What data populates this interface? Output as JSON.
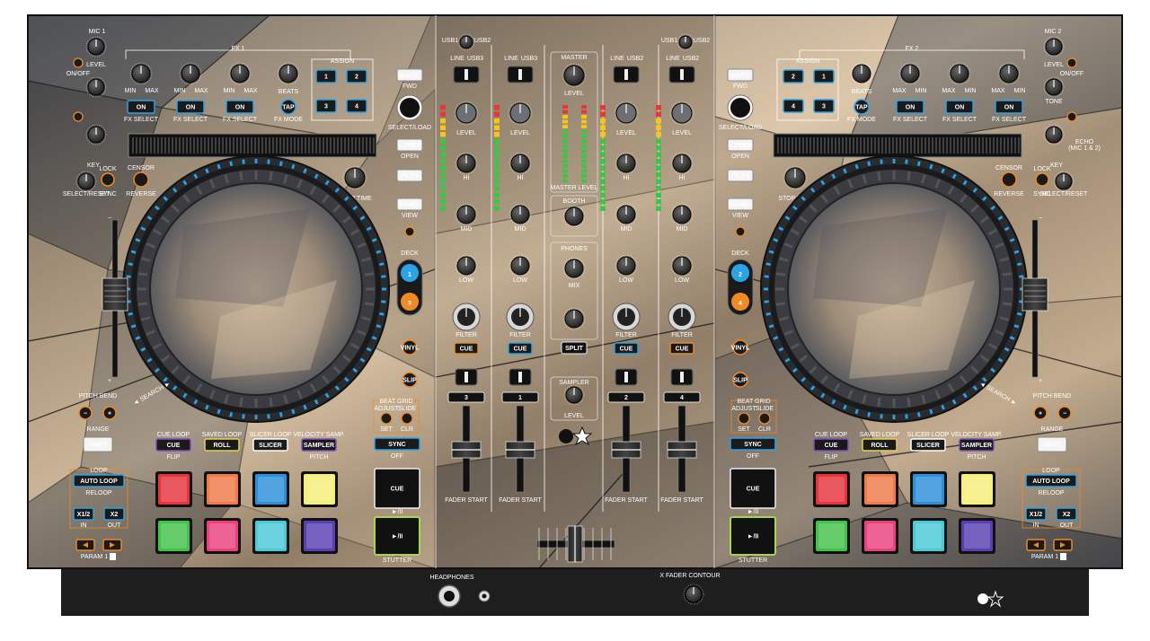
{
  "colors": {
    "blue_accent": "#2aa3e8",
    "orange_accent": "#f08a24",
    "purple_accent": "#7b4fc4",
    "yellow_accent": "#e8d34a",
    "frame": "#1a1a1a"
  },
  "mic": {
    "mic1": "MIC 1",
    "mic2": "MIC 2",
    "level": "LEVEL",
    "tone": "TONE",
    "echo": "ECHO",
    "echo_sub": "(MIC 1 & 2)",
    "onoff": "ON/OFF"
  },
  "fx": {
    "fx1": "FX 1",
    "fx2": "FX 2",
    "on": "ON",
    "fx_select": "FX SELECT",
    "beats": "BEATS",
    "tap": "TAP",
    "fx_mode": "FX MODE",
    "assign": "ASSIGN",
    "assign_buttons": [
      "1",
      "2",
      "3",
      "4"
    ],
    "min": "MIN",
    "max": "MAX"
  },
  "nav": {
    "back": "BACK",
    "fwd": "FWD",
    "select_load": "SELECT/LOAD",
    "lprep": "L.PREP",
    "open": "OPEN",
    "files": "FILES",
    "panel": "PANEL",
    "view": "VIEW",
    "deck": "DECK"
  },
  "deck_left": {
    "deck_a": "1",
    "deck_b": "3"
  },
  "deck_right": {
    "deck_a": "2",
    "deck_b": "4"
  },
  "jog": {
    "needle_drop": "NEEDLE DROP",
    "search": "SEARCH"
  },
  "key": {
    "key": "KEY",
    "lock": "LOCK",
    "select_reset": "SELECT/RESET",
    "sync": "SYNC",
    "censor": "CENSOR",
    "reverse": "REVERSE",
    "stop_time": "STOP TIME"
  },
  "pitch": {
    "pitch_bend": "PITCH BEND",
    "range": "RANGE",
    "minus": "−",
    "plus": "+",
    "shift": "SHIFT"
  },
  "modes": {
    "cue_loop": "CUE LOOP",
    "saved_loop": "SAVED LOOP",
    "slicer_loop": "SLICER LOOP",
    "velocity_samp": "VELOCITY SAMP.",
    "cue": "CUE",
    "roll": "ROLL",
    "slicer": "SLICER",
    "sampler": "SAMPLER",
    "flip": "FLIP",
    "pitch": "PITCH"
  },
  "transport": {
    "sync": "SYNC",
    "off": "OFF",
    "cue": "CUE",
    "play": "►/II",
    "stutter": "STUTTER",
    "vinyl": "VINYL",
    "slip": "SLIP"
  },
  "beatgrid": {
    "title": "BEAT GRID",
    "adjust": "ADJUST",
    "slide": "SLIDE",
    "set": "SET",
    "clr": "CLR"
  },
  "loop": {
    "title": "LOOP",
    "auto_loop": "AUTO LOOP",
    "reloop": "RELOOP",
    "half": "X1/2",
    "double": "X2",
    "in": "IN",
    "out": "OUT",
    "param": "PARAM 1",
    "param2": "2"
  },
  "mixer": {
    "usb1": "USB1",
    "usb2": "USB2",
    "usb3": "USB3",
    "usb4": "USB4",
    "line": "LINE",
    "level": "LEVEL",
    "hi": "HI",
    "mid": "MID",
    "low": "LOW",
    "filter": "FILTER",
    "cue": "CUE",
    "master": "MASTER",
    "booth": "BOOTH",
    "phones": "PHONES",
    "mix": "MIX",
    "split": "SPLIT",
    "sampler": "SAMPLER",
    "master_level": "MASTER LEVEL",
    "fader_start": "FADER START",
    "channels": [
      "3",
      "1",
      "2",
      "4"
    ]
  },
  "front": {
    "headphones": "HEADPHONES",
    "xfader_contour": "X FADER CONTOUR"
  }
}
